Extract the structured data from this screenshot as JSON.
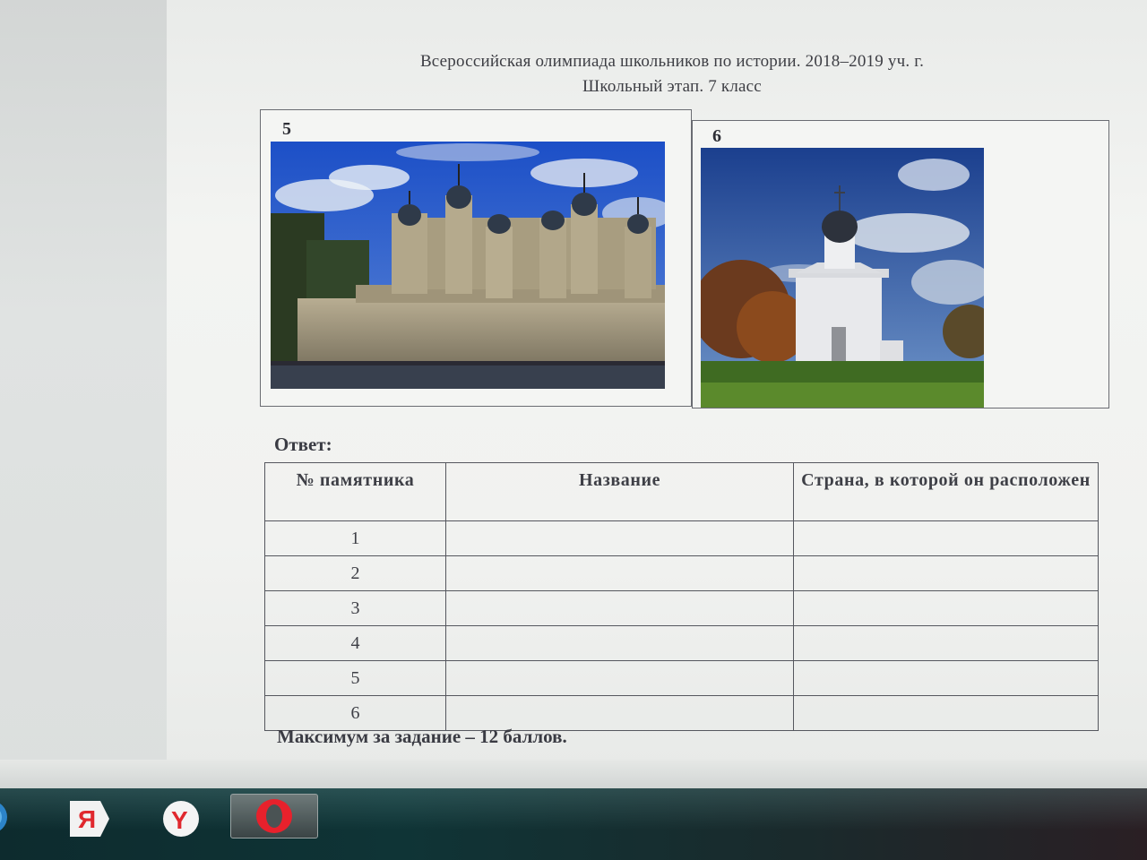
{
  "document": {
    "header_line1": "Всероссийская олимпиада школьников по истории. 2018–2019 уч. г.",
    "header_line2": "Школьный этап. 7 класс",
    "images": [
      {
        "number": "5"
      },
      {
        "number": "6"
      }
    ],
    "answer_label": "Ответ:",
    "table": {
      "headers": [
        "№ памятника",
        "Название",
        "Страна, в которой он расположен"
      ],
      "rows": [
        {
          "num": "1",
          "name": "",
          "country": ""
        },
        {
          "num": "2",
          "name": "",
          "country": ""
        },
        {
          "num": "3",
          "name": "",
          "country": ""
        },
        {
          "num": "4",
          "name": "",
          "country": ""
        },
        {
          "num": "5",
          "name": "",
          "country": ""
        },
        {
          "num": "6",
          "name": "",
          "country": ""
        }
      ]
    },
    "max_score": "Максимум за задание – 12 баллов."
  },
  "taskbar": {
    "items": [
      {
        "icon": "start-orb-icon"
      },
      {
        "icon": "yandex-icon"
      },
      {
        "icon": "yandex-browser-icon"
      },
      {
        "icon": "opera-icon"
      }
    ]
  },
  "colors": {
    "taskbar": "#0f3436",
    "table_border": "#55575e",
    "yandex_red": "#e0282e",
    "opera_red": "#e8212c"
  }
}
